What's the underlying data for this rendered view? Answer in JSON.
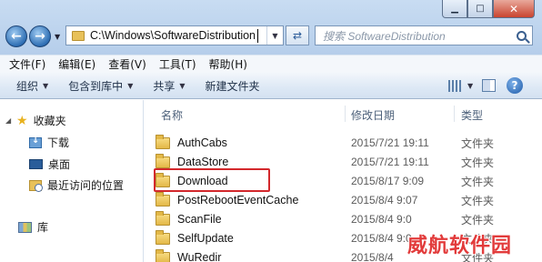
{
  "address": {
    "path": "C:\\Windows\\SoftwareDistribution"
  },
  "search": {
    "placeholder": "搜索 SoftwareDistribution"
  },
  "menu": [
    "文件(F)",
    "编辑(E)",
    "查看(V)",
    "工具(T)",
    "帮助(H)"
  ],
  "toolbar": {
    "organize": "组织",
    "include_library": "包含到库中",
    "share": "共享",
    "new_folder": "新建文件夹"
  },
  "nav": {
    "favorites": "收藏夹",
    "downloads": "下载",
    "desktop": "桌面",
    "recent": "最近访问的位置",
    "libraries": "库"
  },
  "columns": {
    "name": "名称",
    "modified": "修改日期",
    "type": "类型"
  },
  "files": [
    {
      "name": "AuthCabs",
      "date": "2015/7/21 19:11",
      "type": "文件夹"
    },
    {
      "name": "DataStore",
      "date": "2015/7/21 19:11",
      "type": "文件夹"
    },
    {
      "name": "Download",
      "date": "2015/8/17 9:09",
      "type": "文件夹"
    },
    {
      "name": "PostRebootEventCache",
      "date": "2015/8/4 9:07",
      "type": "文件夹"
    },
    {
      "name": "ScanFile",
      "date": "2015/8/4 9:0",
      "type": "文件夹"
    },
    {
      "name": "SelfUpdate",
      "date": "2015/8/4 9:0",
      "type": "文件夹"
    },
    {
      "name": "WuRedir",
      "date": "2015/8/4",
      "type": "文件夹"
    }
  ],
  "watermark": "威航软件园",
  "colors": {
    "highlight_box": "#d3282c",
    "watermark": "#e23b3b"
  }
}
